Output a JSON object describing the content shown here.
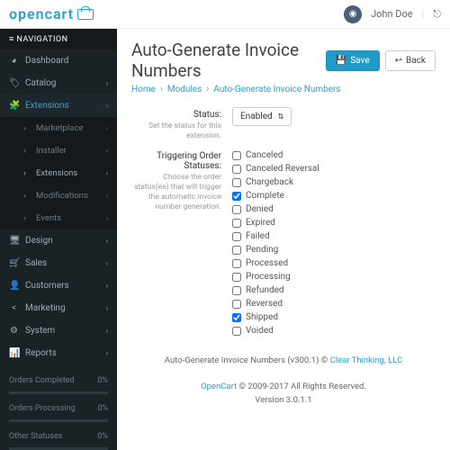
{
  "brand": "opencart",
  "user": "John Doe",
  "nav_header": "NAVIGATION",
  "nav": [
    {
      "icon": "◕",
      "label": "Dashboard"
    },
    {
      "icon": "🏷",
      "label": "Catalog",
      "chev": true
    },
    {
      "icon": "🧩",
      "label": "Extensions",
      "chev": true,
      "active": true
    },
    {
      "icon": "🖥",
      "label": "Design",
      "chev": true
    },
    {
      "icon": "🛒",
      "label": "Sales",
      "chev": true
    },
    {
      "icon": "👤",
      "label": "Customers",
      "chev": true
    },
    {
      "icon": "<",
      "label": "Marketing",
      "chev": true
    },
    {
      "icon": "⚙",
      "label": "System",
      "chev": true
    },
    {
      "icon": "📊",
      "label": "Reports",
      "chev": true
    }
  ],
  "subnav": [
    {
      "label": "Marketplace",
      "chev": true
    },
    {
      "label": "Installer",
      "chev": true
    },
    {
      "label": "Extensions",
      "chev": true,
      "active": true
    },
    {
      "label": "Modifications",
      "chev": true
    },
    {
      "label": "Events",
      "chev": true
    }
  ],
  "stats": [
    {
      "label": "Orders Completed",
      "val": "0%"
    },
    {
      "label": "Orders Processing",
      "val": "0%"
    },
    {
      "label": "Other Statuses",
      "val": "0%"
    }
  ],
  "page_title": "Auto-Generate Invoice Numbers",
  "save": "Save",
  "back": "Back",
  "crumbs": {
    "home": "Home",
    "modules": "Modules",
    "current": "Auto-Generate Invoice Numbers"
  },
  "status_label": "Status:",
  "status_help": "Set the status for this extension.",
  "status_value": "Enabled",
  "trig_label": "Triggering Order Statuses:",
  "trig_help": "Choose the order status(es) that will trigger the automatic invoice number generation.",
  "statuses": [
    {
      "name": "Canceled",
      "checked": false
    },
    {
      "name": "Canceled Reversal",
      "checked": false
    },
    {
      "name": "Chargeback",
      "checked": false
    },
    {
      "name": "Complete",
      "checked": true
    },
    {
      "name": "Denied",
      "checked": false
    },
    {
      "name": "Expired",
      "checked": false
    },
    {
      "name": "Failed",
      "checked": false
    },
    {
      "name": "Pending",
      "checked": false
    },
    {
      "name": "Processed",
      "checked": false
    },
    {
      "name": "Processing",
      "checked": false
    },
    {
      "name": "Refunded",
      "checked": false
    },
    {
      "name": "Reversed",
      "checked": false
    },
    {
      "name": "Shipped",
      "checked": true
    },
    {
      "name": "Voided",
      "checked": false
    }
  ],
  "footer1a": "Auto-Generate Invoice Numbers (v300.1) © ",
  "footer1b": "Clear Thinking, LLC",
  "footer2a": "OpenCart",
  "footer2b": " © 2009-2017 All Rights Reserved.",
  "footer3": "Version 3.0.1.1"
}
